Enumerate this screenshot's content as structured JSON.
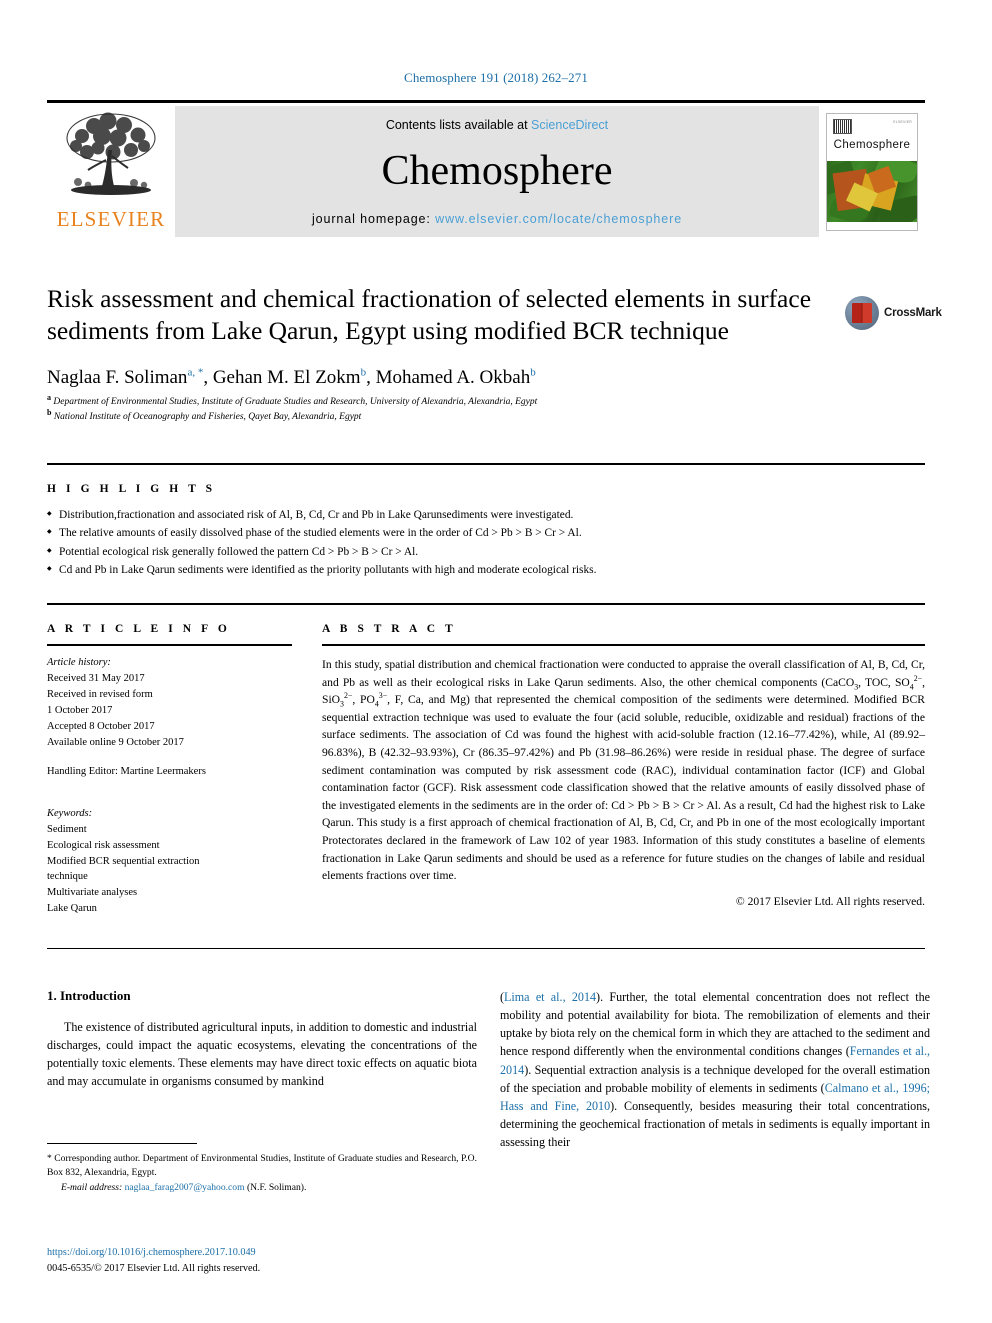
{
  "running_head": "Chemosphere 191 (2018) 262–271",
  "masthead": {
    "publisher_name": "ELSEVIER",
    "contents_prefix": "Contents lists available at ",
    "contents_link": "ScienceDirect",
    "journal_name": "Chemosphere",
    "homepage_label": "journal homepage:",
    "homepage_url": "www.elsevier.com/locate/chemosphere",
    "cover": {
      "title": "Chemosphere",
      "publisher_mark": "ELSEVIER"
    }
  },
  "article": {
    "title": "Risk assessment and chemical fractionation of selected elements in surface sediments from Lake Qarun, Egypt using modified BCR technique",
    "authors": [
      {
        "name": "Naglaa F. Soliman",
        "marks": "a, *"
      },
      {
        "name": "Gehan M. El Zokm",
        "marks": "b"
      },
      {
        "name": "Mohamed A. Okbah",
        "marks": "b"
      }
    ],
    "authors_line": "Naglaa F. Soliman a, *, Gehan M. El Zokm b, Mohamed A. Okbah b",
    "affiliations": [
      {
        "mark": "a",
        "text": "Department of Environmental Studies, Institute of Graduate Studies and Research, University of Alexandria, Alexandria, Egypt"
      },
      {
        "mark": "b",
        "text": "National Institute of Oceanography and Fisheries, Qayet Bay, Alexandria, Egypt"
      }
    ],
    "crossmark_label": "CrossMark"
  },
  "highlights": {
    "heading": "H I G H L I G H T S",
    "items": [
      "Distribution,fractionation and associated risk of Al, B, Cd, Cr and Pb in Lake Qarunsediments were investigated.",
      "The relative amounts of easily dissolved phase of the studied elements were in the order of Cd > Pb > B > Cr > Al.",
      "Potential ecological risk generally followed the pattern Cd > Pb > B > Cr > Al.",
      "Cd and Pb in Lake Qarun sediments were identified as the priority pollutants with high and moderate ecological risks."
    ]
  },
  "article_info": {
    "heading": "A R T I C L E   I N F O",
    "history_label": "Article history:",
    "history": [
      "Received 31 May 2017",
      "Received in revised form",
      "1 October 2017",
      "Accepted 8 October 2017",
      "Available online 9 October 2017"
    ],
    "handling_editor": "Handling Editor: Martine Leermakers",
    "keywords_label": "Keywords:",
    "keywords": [
      "Sediment",
      "Ecological risk assessment",
      "Modified BCR sequential extraction",
      "technique",
      "Multivariate analyses",
      "Lake Qarun"
    ]
  },
  "abstract": {
    "heading": "A B S T R A C T",
    "part1": "In this study, spatial distribution and chemical fractionation were conducted to appraise the overall classification of Al, B, Cd, Cr, and Pb as well as their ecological risks in Lake Qarun sediments. Also, the other chemical components (CaCO",
    "formula_caco3_sub": "3",
    "part2": ", TOC, SO",
    "so4_sub": "4",
    "so4_sup": "2−",
    "part3": ", SiO",
    "sio3_sub": "3",
    "sio3_sup": "2−",
    "part4": ", PO",
    "po4_sub": "4",
    "po4_sup": "3−",
    "part5": ", F, Ca, and Mg) that represented the chemical composition of the sediments were determined. Modified BCR sequential extraction technique was used to evaluate the four (acid soluble, reducible, oxidizable and residual) fractions of the surface sediments. The association of Cd was found the highest with acid-soluble fraction (12.16–77.42%), while, Al (89.92–96.83%), B (42.32–93.93%), Cr (86.35–97.42%) and Pb (31.98–86.26%) were reside in residual phase. The degree of surface sediment contamination was computed by risk assessment code (RAC), individual contamination factor (ICF) and Global contamination factor (GCF). Risk assessment code classification showed that the relative amounts of easily dissolved phase of the investigated elements in the sediments are in the order of: Cd > Pb > B > Cr > Al. As a result, Cd had the highest risk to Lake Qarun. This study is a first approach of chemical fractionation of Al, B, Cd, Cr, and Pb in one of the most ecologically important Protectorates declared in the framework of Law 102 of year 1983. Information of this study constitutes a baseline of elements fractionation in Lake Qarun sediments and should be used as a reference for future studies on the changes of labile and residual elements fractions over time.",
    "copyright": "© 2017 Elsevier Ltd. All rights reserved."
  },
  "introduction": {
    "heading": "1. Introduction",
    "left_para": "The existence of distributed agricultural inputs, in addition to domestic and industrial discharges, could impact the aquatic ecosystems, elevating the concentrations of the potentially toxic elements. These elements may have direct toxic effects on aquatic biota and may accumulate in organisms consumed by mankind",
    "right": {
      "cite1": "Lima et al., 2014",
      "seg1": "). Further, the total elemental concentration does not reflect the mobility and potential availability for biota. The remobilization of elements and their uptake by biota rely on the chemical form in which they are attached to the sediment and hence respond differently when the environmental conditions changes (",
      "cite2": "Fernandes et al., 2014",
      "seg2": "). Sequential extraction analysis is a technique developed for the overall estimation of the speciation and probable mobility of elements in sediments (",
      "cite3": "Calmano et al., 1996; Hass and Fine, 2010",
      "seg3": "). Consequently, besides measuring their total concentrations, determining the geochemical fractionation of metals in sediments is equally important in assessing their"
    }
  },
  "footnotes": {
    "corresponding": "* Corresponding author. Department of Environmental Studies, Institute of Graduate studies and Research, P.O. Box 832, Alexandria, Egypt.",
    "email_label": "E-mail address:",
    "email": "naglaa_farag2007@yahoo.com",
    "email_owner": "(N.F. Soliman).",
    "doi": "https://doi.org/10.1016/j.chemosphere.2017.10.049",
    "issn_line": "0045-6535/© 2017 Elsevier Ltd. All rights reserved."
  },
  "colors": {
    "link": "#1C6FA8",
    "science_direct": "#4A9FD4",
    "elsevier_orange": "#E8821E",
    "band_gray": "#E3E3E3"
  }
}
